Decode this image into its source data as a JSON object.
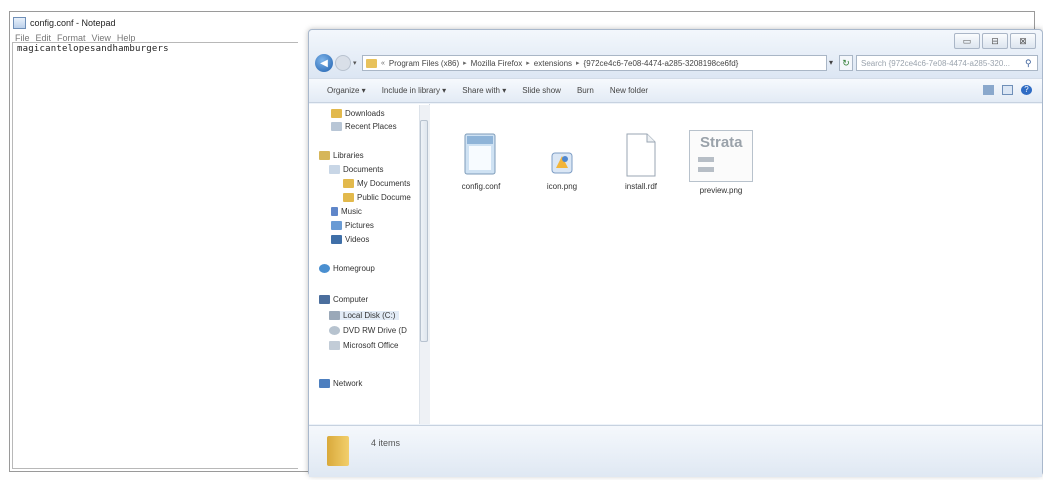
{
  "notepad": {
    "title": "config.conf - Notepad",
    "menu": [
      "File",
      "Edit",
      "Format",
      "View",
      "Help"
    ],
    "content": "magicantelopesandhamburgers"
  },
  "explorer": {
    "window_buttons": [
      "▭",
      "⊟",
      "⊠"
    ],
    "address": {
      "prefix": "«",
      "segments": [
        "Program Files (x86)",
        "Mozilla Firefox",
        "extensions",
        "{972ce4c6-7e08-4474-a285-3208198ce6fd}"
      ],
      "separator": "▸"
    },
    "search_placeholder": "Search {972ce4c6-7e08-4474-a285-320...",
    "toolbar": {
      "organize": "Organize ▾",
      "include": "Include in library ▾",
      "share": "Share with ▾",
      "slideshow": "Slide show",
      "burn": "Burn",
      "newfolder": "New folder"
    },
    "nav": {
      "downloads": "Downloads",
      "recent": "Recent Places",
      "libraries": "Libraries",
      "documents": "Documents",
      "mydocs": "My Documents",
      "publicdocs": "Public Docume",
      "music": "Music",
      "pictures": "Pictures",
      "videos": "Videos",
      "homegroup": "Homegroup",
      "computer": "Computer",
      "localdisk": "Local Disk (C:)",
      "dvd": "DVD RW Drive (D",
      "office": "Microsoft Office",
      "network": "Network"
    },
    "files": {
      "f1": "config.conf",
      "f2": "icon.png",
      "f3": "install.rdf",
      "f4": "preview.png",
      "preview_text": "Strata"
    },
    "status": "4 items"
  },
  "colors": {
    "explorer_chrome": "#eef3f9",
    "folder": "#e8c25c",
    "accent": "#2f6cc4"
  }
}
